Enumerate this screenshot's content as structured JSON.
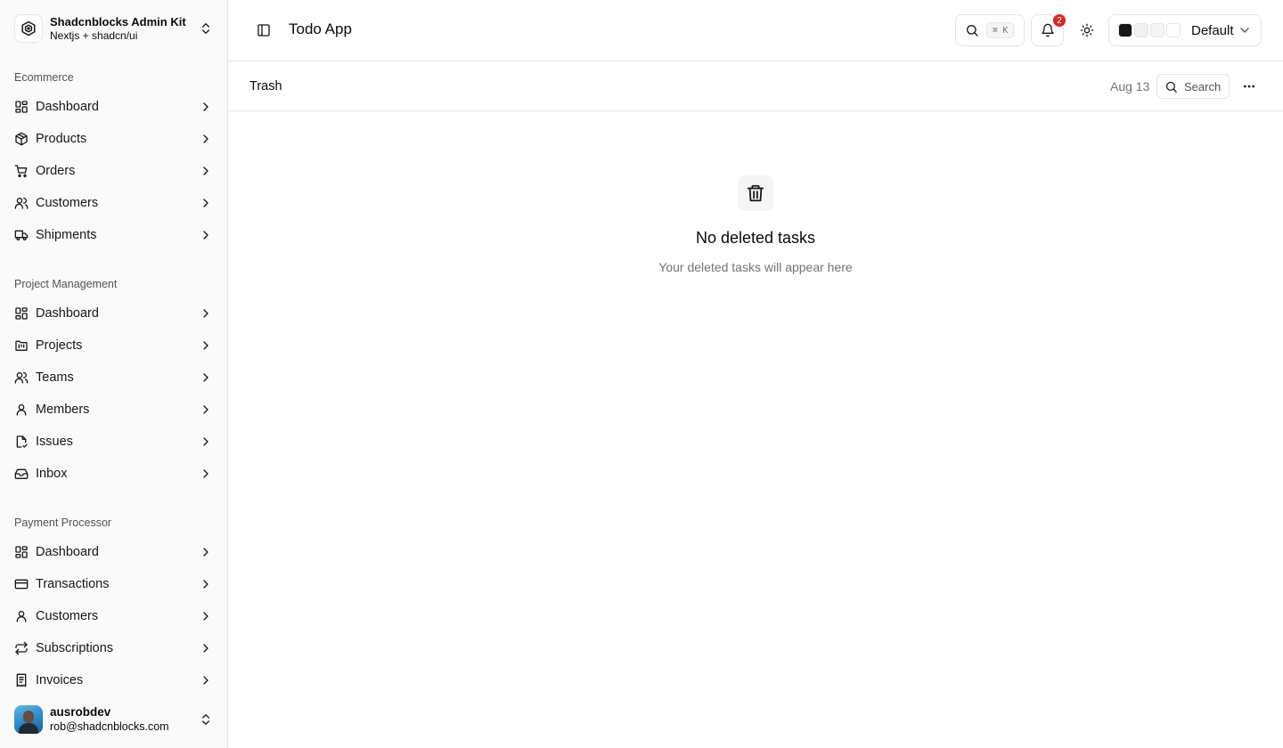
{
  "brand": {
    "title": "Shadcnblocks Admin Kit",
    "subtitle": "Nextjs + shadcn/ui"
  },
  "sidebar": {
    "groups": [
      {
        "label": "Ecommerce",
        "items": [
          {
            "label": "Dashboard",
            "icon": "layout-dashboard-icon"
          },
          {
            "label": "Products",
            "icon": "package-icon"
          },
          {
            "label": "Orders",
            "icon": "shopping-cart-icon"
          },
          {
            "label": "Customers",
            "icon": "users-icon"
          },
          {
            "label": "Shipments",
            "icon": "truck-icon"
          }
        ]
      },
      {
        "label": "Project Management",
        "items": [
          {
            "label": "Dashboard",
            "icon": "layout-dashboard-icon"
          },
          {
            "label": "Projects",
            "icon": "folder-kanban-icon"
          },
          {
            "label": "Teams",
            "icon": "users-icon"
          },
          {
            "label": "Members",
            "icon": "user-icon"
          },
          {
            "label": "Issues",
            "icon": "file-check-icon"
          },
          {
            "label": "Inbox",
            "icon": "inbox-icon"
          }
        ]
      },
      {
        "label": "Payment Processor",
        "items": [
          {
            "label": "Dashboard",
            "icon": "layout-dashboard-icon"
          },
          {
            "label": "Transactions",
            "icon": "credit-card-icon"
          },
          {
            "label": "Customers",
            "icon": "user-icon"
          },
          {
            "label": "Subscriptions",
            "icon": "repeat-icon"
          },
          {
            "label": "Invoices",
            "icon": "receipt-icon"
          }
        ]
      }
    ]
  },
  "user": {
    "name": "ausrobdev",
    "email": "rob@shadcnblocks.com"
  },
  "header": {
    "title": "Todo App",
    "search_shortcut": "⌘ K",
    "notification_count": "2",
    "theme_label": "Default",
    "theme_swatches": [
      "#171717",
      "#f0f0f0",
      "#f5f5f5",
      "#ffffff"
    ]
  },
  "toolbar": {
    "crumb": "Trash",
    "date": "Aug 13",
    "search_label": "Search"
  },
  "empty": {
    "title": "No deleted tasks",
    "subtitle": "Your deleted tasks will appear here"
  }
}
